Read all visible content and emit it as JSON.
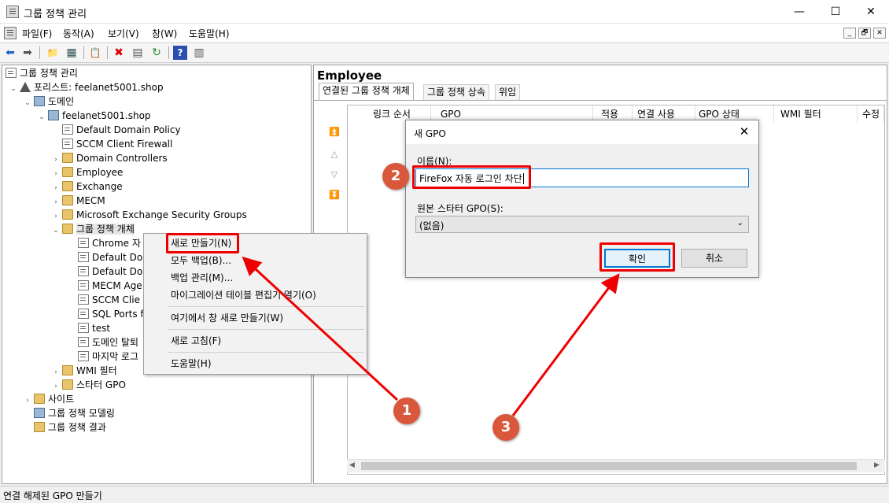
{
  "window": {
    "title": "그룹 정책 관리",
    "minimize": "—",
    "maximize": "☐",
    "close": "✕"
  },
  "menu": [
    "파일(F)",
    "동작(A)",
    "보기(V)",
    "창(W)",
    "도움말(H)"
  ],
  "mdi_controls": [
    "_",
    "🗗",
    "✕"
  ],
  "toolbar": {
    "icons": [
      "back-icon",
      "forward-icon",
      "up-folder-icon",
      "show-hide-tree-icon",
      "clipboard-icon",
      "delete-icon",
      "properties-icon",
      "refresh-icon",
      "help-icon",
      "console-icon"
    ],
    "glyphs": [
      "⬅",
      "➡",
      "📁",
      "▦",
      "📋",
      "✖",
      "▤",
      "↻",
      "?",
      "▥"
    ]
  },
  "tree": {
    "root": "그룹 정책 관리",
    "forest": "포리스트: feelanet5001.shop",
    "domains": "도메인",
    "domain": "feelanet5001.shop",
    "linked_gpos": [
      "Default Domain Policy",
      "SCCM Client Firewall"
    ],
    "ous": [
      "Domain Controllers",
      "Employee",
      "Exchange",
      "MECM",
      "Microsoft Exchange Security Groups"
    ],
    "gpo_container": "그룹 정책 개체",
    "gpo_items": [
      "Chrome 자",
      "Default Do",
      "Default Do",
      "MECM Age",
      "SCCM Clie",
      "SQL Ports f",
      "test",
      "도메인 탈퇴",
      "마지막 로그"
    ],
    "wmi": "WMI 필터",
    "starter": "스타터 GPO",
    "sites": "사이트",
    "modeling": "그룹 정책 모델링",
    "results": "그룹 정책 결과"
  },
  "right": {
    "title": "Employee",
    "tabs": [
      "연결된 그룹 정책 개체",
      "그룹 정책 상속",
      "위임"
    ],
    "columns": [
      "링크 순서",
      "GPO",
      "적용",
      "연결 사용",
      "GPO 상태",
      "WMI 필터",
      "수정"
    ]
  },
  "context_menu": {
    "items": [
      "새로 만들기(N)",
      "모두 백업(B)...",
      "백업 관리(M)...",
      "마이그레이션 테이블 편집기 열기(O)",
      "여기에서 창 새로 만들기(W)",
      "새로 고침(F)",
      "도움말(H)"
    ]
  },
  "dialog": {
    "title": "새 GPO",
    "name_label": "이름(N):",
    "name_value": "FireFox 자동 로그인 차단",
    "starter_label": "원본 스타터 GPO(S):",
    "starter_value": "(없음)",
    "ok": "확인",
    "cancel": "취소",
    "close": "✕"
  },
  "status": "연결 해제된 GPO 만들기",
  "annotations": {
    "step1": "1",
    "step2": "2",
    "step3": "3",
    "highlight_color": "#e00000",
    "marker_color": "#d9573a"
  }
}
